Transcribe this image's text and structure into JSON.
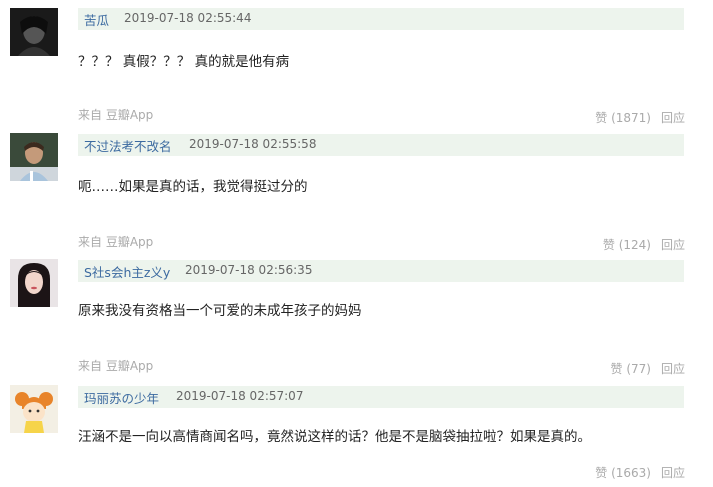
{
  "comments": [
    {
      "author": "苦瓜",
      "time": "2019-07-18 02:55:44",
      "text": "？？？ 真假？？？ 真的就是他有病",
      "source": "来自 豆瓣App",
      "like": "赞 (1871)",
      "reply": "回应",
      "avatar_icon": "dark-portrait-avatar-icon"
    },
    {
      "author": "不过法考不改名",
      "time": "2019-07-18 02:55:58",
      "text": "呃……如果是真的话，我觉得挺过分的",
      "source": "来自 豆瓣App",
      "like": "赞 (124)",
      "reply": "回应",
      "avatar_icon": "football-player-avatar-icon"
    },
    {
      "author": "S社s会h主z义y",
      "time": "2019-07-18 02:56:35",
      "text": "原来我没有资格当一个可爱的未成年孩子的妈妈",
      "source": "来自 豆瓣App",
      "like": "赞 (77)",
      "reply": "回应",
      "avatar_icon": "woman-portrait-avatar-icon"
    },
    {
      "author": "玛丽苏の少年",
      "time": "2019-07-18 02:57:07",
      "text": "汪涵不是一向以高情商闻名吗，竟然说这样的话？他是不是脑袋抽拉啦？如果是真的。",
      "source": "",
      "like": "赞 (1663)",
      "reply": "回应",
      "avatar_icon": "cartoon-girl-avatar-icon"
    }
  ]
}
